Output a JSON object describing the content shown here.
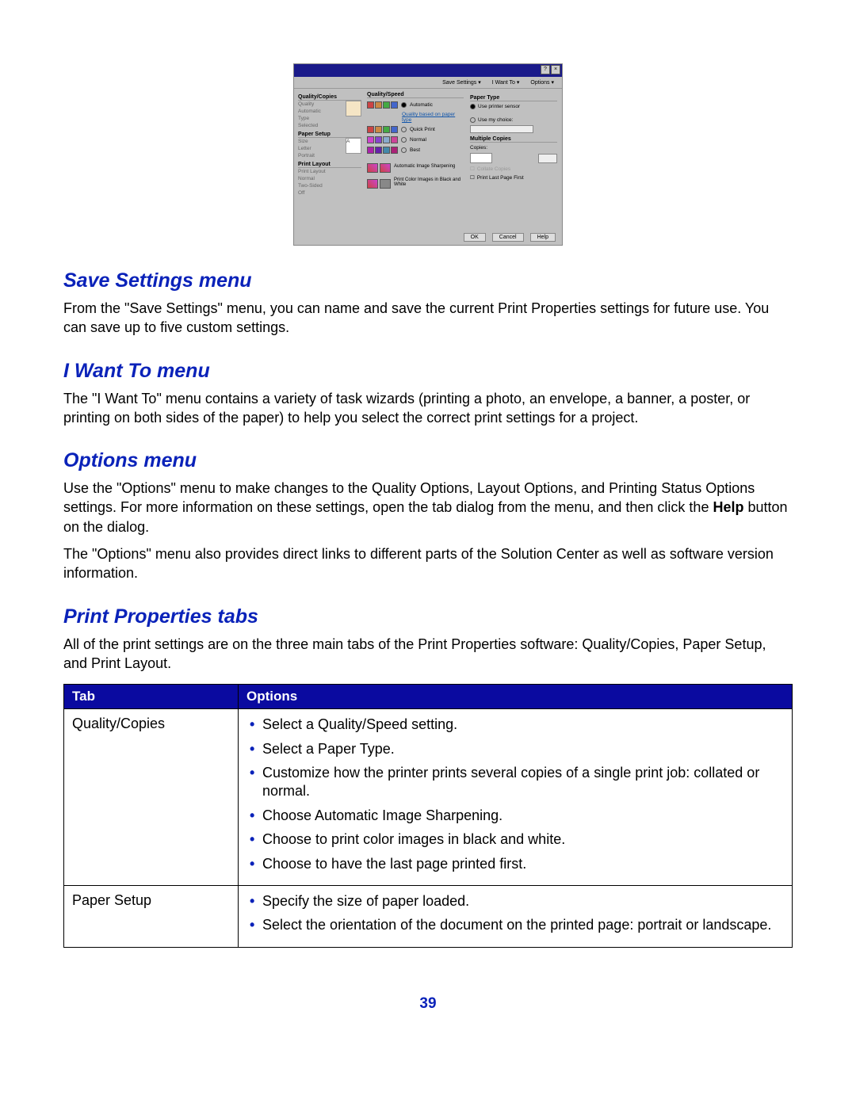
{
  "dialog": {
    "menus": [
      "Save Settings ▾",
      "I Want To ▾",
      "Options ▾"
    ],
    "titlebar_buttons": [
      "?",
      "×"
    ],
    "left_panel": {
      "quality_label": "Quality/Copies",
      "quality_items": [
        "Quality",
        "Automatic",
        "Type",
        "Selected"
      ],
      "paper_label": "Paper Setup",
      "paper_items": [
        "Size",
        "Letter",
        "Portrait"
      ],
      "layout_label": "Print Layout",
      "layout_items": [
        "Print Layout",
        "Normal",
        "Two-Sided",
        "Off"
      ]
    },
    "mid_panel": {
      "label": "Quality/Speed",
      "opts": [
        "Automatic",
        "Quality based on paper type",
        "Quick Print",
        "Normal",
        "Best"
      ],
      "bottom1": "Automatic Image Sharpening",
      "bottom2": "Print Color Images in Black and White"
    },
    "right_panel": {
      "paper_type_label": "Paper Type",
      "use_printer": "Use printer sensor",
      "use_my_choice": "Use my choice:",
      "multi_label": "Multiple Copies",
      "copies_label": "Copies:",
      "collate": "Collate Copies",
      "last_first": "Print Last Page First"
    },
    "buttons": [
      "OK",
      "Cancel",
      "Help"
    ]
  },
  "sections": {
    "save_settings_h": "Save Settings menu",
    "save_settings_p": "From the \"Save Settings\" menu, you can name and save the current Print Properties settings for future use. You can save up to five custom settings.",
    "iwantto_h": "I Want To menu",
    "iwantto_p": "The \"I Want To\" menu contains a variety of task wizards (printing a photo, an envelope, a banner, a poster, or printing on both sides of the paper) to help you select the correct print settings for a project.",
    "options_h": "Options menu",
    "options_p1a": "Use the \"Options\" menu to make changes to the Quality Options, Layout Options, and Printing Status Options settings. For more information on these settings, open the tab dialog from the menu, and then click the ",
    "options_p1b": "Help",
    "options_p1c": " button on the dialog.",
    "options_p2": "The \"Options\" menu also provides direct links to different parts of the Solution Center as well as software version information.",
    "print_prop_h": "Print Properties tabs",
    "print_prop_p": "All of the print settings are on the three main tabs of the Print Properties software: Quality/Copies, Paper Setup, and Print Layout."
  },
  "table": {
    "head_tab": "Tab",
    "head_opts": "Options",
    "rows": [
      {
        "tab": "Quality/Copies",
        "opts": [
          "Select a Quality/Speed setting.",
          "Select a Paper Type.",
          "Customize how the printer prints several copies of a single print job: collated or normal.",
          "Choose Automatic Image Sharpening.",
          "Choose to print color images in black and white.",
          "Choose to have the last page printed first."
        ]
      },
      {
        "tab": "Paper Setup",
        "opts": [
          "Specify the size of paper loaded.",
          "Select the orientation of the document on the printed page: portrait or landscape."
        ]
      }
    ]
  },
  "page_number": "39"
}
